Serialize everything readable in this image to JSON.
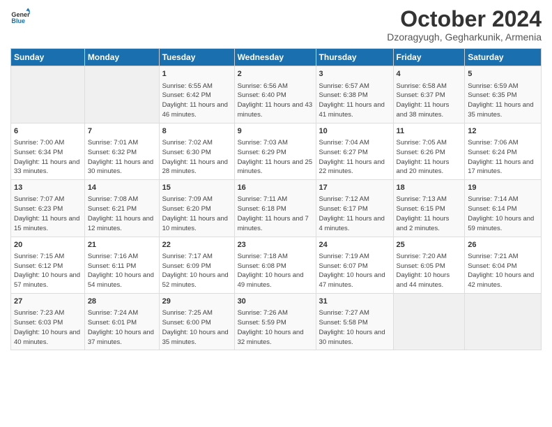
{
  "header": {
    "logo_line1": "General",
    "logo_line2": "Blue",
    "main_title": "October 2024",
    "subtitle": "Dzoragyugh, Gegharkunik, Armenia"
  },
  "weekdays": [
    "Sunday",
    "Monday",
    "Tuesday",
    "Wednesday",
    "Thursday",
    "Friday",
    "Saturday"
  ],
  "weeks": [
    [
      {
        "day": "",
        "empty": true
      },
      {
        "day": "",
        "empty": true
      },
      {
        "day": "1",
        "sunrise": "6:55 AM",
        "sunset": "6:42 PM",
        "daylight": "11 hours and 46 minutes."
      },
      {
        "day": "2",
        "sunrise": "6:56 AM",
        "sunset": "6:40 PM",
        "daylight": "11 hours and 43 minutes."
      },
      {
        "day": "3",
        "sunrise": "6:57 AM",
        "sunset": "6:38 PM",
        "daylight": "11 hours and 41 minutes."
      },
      {
        "day": "4",
        "sunrise": "6:58 AM",
        "sunset": "6:37 PM",
        "daylight": "11 hours and 38 minutes."
      },
      {
        "day": "5",
        "sunrise": "6:59 AM",
        "sunset": "6:35 PM",
        "daylight": "11 hours and 35 minutes."
      }
    ],
    [
      {
        "day": "6",
        "sunrise": "7:00 AM",
        "sunset": "6:34 PM",
        "daylight": "11 hours and 33 minutes."
      },
      {
        "day": "7",
        "sunrise": "7:01 AM",
        "sunset": "6:32 PM",
        "daylight": "11 hours and 30 minutes."
      },
      {
        "day": "8",
        "sunrise": "7:02 AM",
        "sunset": "6:30 PM",
        "daylight": "11 hours and 28 minutes."
      },
      {
        "day": "9",
        "sunrise": "7:03 AM",
        "sunset": "6:29 PM",
        "daylight": "11 hours and 25 minutes."
      },
      {
        "day": "10",
        "sunrise": "7:04 AM",
        "sunset": "6:27 PM",
        "daylight": "11 hours and 22 minutes."
      },
      {
        "day": "11",
        "sunrise": "7:05 AM",
        "sunset": "6:26 PM",
        "daylight": "11 hours and 20 minutes."
      },
      {
        "day": "12",
        "sunrise": "7:06 AM",
        "sunset": "6:24 PM",
        "daylight": "11 hours and 17 minutes."
      }
    ],
    [
      {
        "day": "13",
        "sunrise": "7:07 AM",
        "sunset": "6:23 PM",
        "daylight": "11 hours and 15 minutes."
      },
      {
        "day": "14",
        "sunrise": "7:08 AM",
        "sunset": "6:21 PM",
        "daylight": "11 hours and 12 minutes."
      },
      {
        "day": "15",
        "sunrise": "7:09 AM",
        "sunset": "6:20 PM",
        "daylight": "11 hours and 10 minutes."
      },
      {
        "day": "16",
        "sunrise": "7:11 AM",
        "sunset": "6:18 PM",
        "daylight": "11 hours and 7 minutes."
      },
      {
        "day": "17",
        "sunrise": "7:12 AM",
        "sunset": "6:17 PM",
        "daylight": "11 hours and 4 minutes."
      },
      {
        "day": "18",
        "sunrise": "7:13 AM",
        "sunset": "6:15 PM",
        "daylight": "11 hours and 2 minutes."
      },
      {
        "day": "19",
        "sunrise": "7:14 AM",
        "sunset": "6:14 PM",
        "daylight": "10 hours and 59 minutes."
      }
    ],
    [
      {
        "day": "20",
        "sunrise": "7:15 AM",
        "sunset": "6:12 PM",
        "daylight": "10 hours and 57 minutes."
      },
      {
        "day": "21",
        "sunrise": "7:16 AM",
        "sunset": "6:11 PM",
        "daylight": "10 hours and 54 minutes."
      },
      {
        "day": "22",
        "sunrise": "7:17 AM",
        "sunset": "6:09 PM",
        "daylight": "10 hours and 52 minutes."
      },
      {
        "day": "23",
        "sunrise": "7:18 AM",
        "sunset": "6:08 PM",
        "daylight": "10 hours and 49 minutes."
      },
      {
        "day": "24",
        "sunrise": "7:19 AM",
        "sunset": "6:07 PM",
        "daylight": "10 hours and 47 minutes."
      },
      {
        "day": "25",
        "sunrise": "7:20 AM",
        "sunset": "6:05 PM",
        "daylight": "10 hours and 44 minutes."
      },
      {
        "day": "26",
        "sunrise": "7:21 AM",
        "sunset": "6:04 PM",
        "daylight": "10 hours and 42 minutes."
      }
    ],
    [
      {
        "day": "27",
        "sunrise": "7:23 AM",
        "sunset": "6:03 PM",
        "daylight": "10 hours and 40 minutes."
      },
      {
        "day": "28",
        "sunrise": "7:24 AM",
        "sunset": "6:01 PM",
        "daylight": "10 hours and 37 minutes."
      },
      {
        "day": "29",
        "sunrise": "7:25 AM",
        "sunset": "6:00 PM",
        "daylight": "10 hours and 35 minutes."
      },
      {
        "day": "30",
        "sunrise": "7:26 AM",
        "sunset": "5:59 PM",
        "daylight": "10 hours and 32 minutes."
      },
      {
        "day": "31",
        "sunrise": "7:27 AM",
        "sunset": "5:58 PM",
        "daylight": "10 hours and 30 minutes."
      },
      {
        "day": "",
        "empty": true
      },
      {
        "day": "",
        "empty": true
      }
    ]
  ]
}
